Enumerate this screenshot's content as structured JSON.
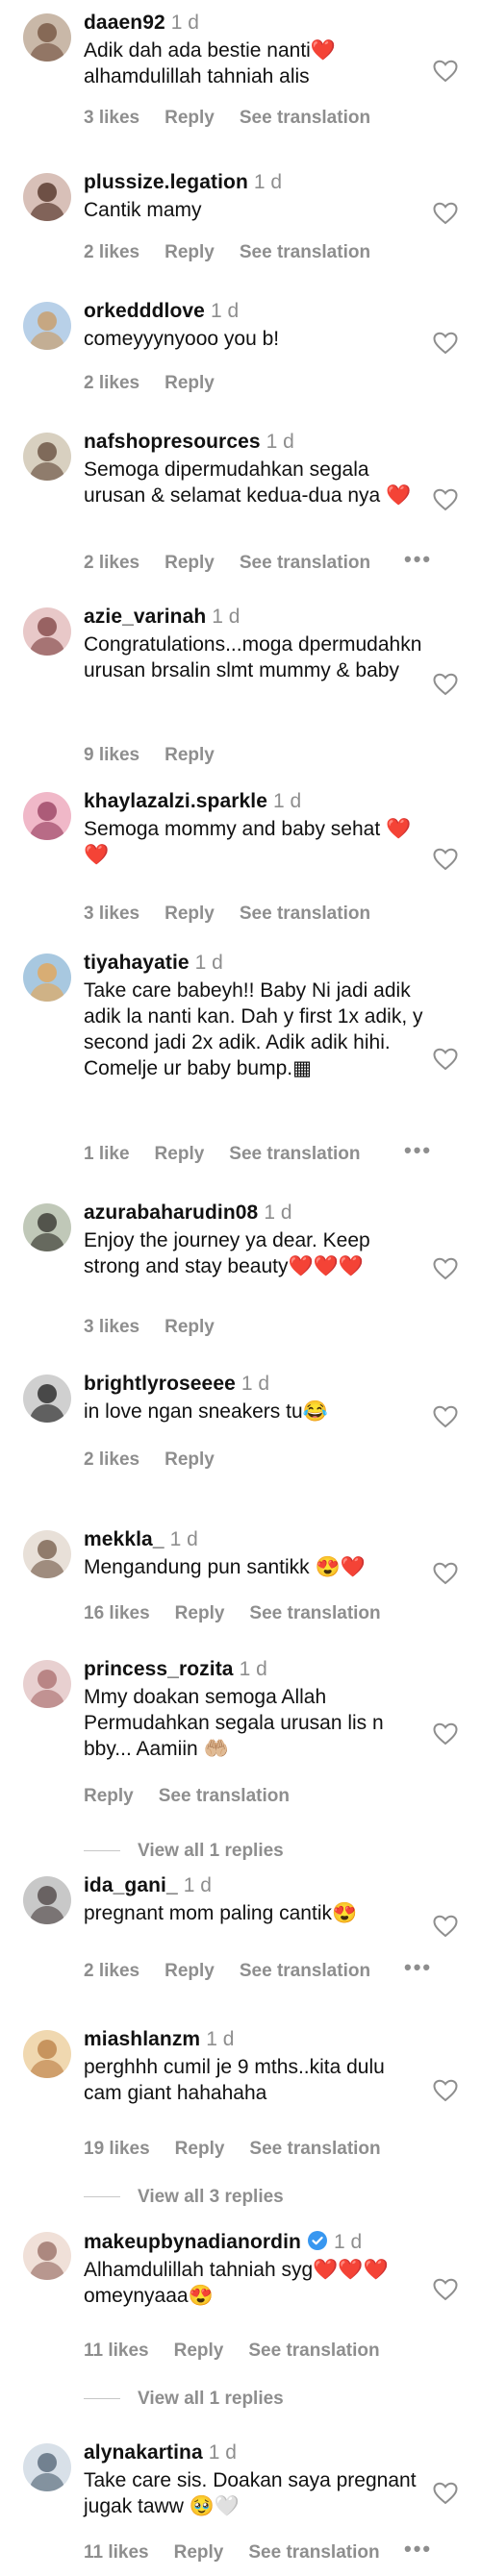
{
  "colors": {
    "text": "#111111",
    "muted": "#8e8e8e",
    "heart_emoji": "#e0102a",
    "verified": "#3897f0"
  },
  "icons": {
    "like": "heart-outline-icon",
    "more": "more-horizontal-icon",
    "verified": "verified-badge-icon"
  },
  "comments": [
    {
      "user": "daaen92",
      "time": "1 d",
      "text": "Adik dah ada bestie nanti❤️ alhamdulillah tahniah alis",
      "likes": "3 likes",
      "reply": "Reply",
      "translate": "See translation"
    },
    {
      "user": "plussize.legation",
      "time": "1 d",
      "text": "Cantik mamy",
      "likes": "2 likes",
      "reply": "Reply",
      "translate": "See translation"
    },
    {
      "user": "orkedddlove",
      "time": "1 d",
      "text": "comeyyynyooo you b!",
      "likes": "2 likes",
      "reply": "Reply"
    },
    {
      "user": "nafshopresources",
      "time": "1 d",
      "text": "Semoga dipermudahkan segala urusan & selamat kedua-dua nya ❤️",
      "likes": "2 likes",
      "reply": "Reply",
      "translate": "See translation",
      "more": "•••"
    },
    {
      "user": "azie_varinah",
      "time": "1 d",
      "text": "Congratulations...moga dpermudahkn urusan brsalin slmt mummy & baby",
      "likes": "9 likes",
      "reply": "Reply"
    },
    {
      "user": "khaylazalzi.sparkle",
      "time": "1 d",
      "text": "Semoga mommy and baby sehat ❤️❤️",
      "likes": "3 likes",
      "reply": "Reply",
      "translate": "See translation"
    },
    {
      "user": "tiyahayatie",
      "time": "1 d",
      "text": "Take care babeyh!! Baby Ni jadi adik adik la nanti kan. Dah y first 1x adik, y second jadi 2x adik. Adik adik hihi. Comelje ur baby bump.▦",
      "likes": "1 like",
      "reply": "Reply",
      "translate": "See translation",
      "more": "•••"
    },
    {
      "user": "azurabaharudin08",
      "time": "1 d",
      "text": "Enjoy the journey ya dear. Keep strong and stay beauty❤️❤️❤️",
      "likes": "3 likes",
      "reply": "Reply"
    },
    {
      "user": "brightlyroseeee",
      "time": "1 d",
      "text": "in love ngan sneakers tu😂",
      "likes": "2 likes",
      "reply": "Reply"
    },
    {
      "user": "mekkla_",
      "time": "1 d",
      "text": "Mengandung pun santikk 😍❤️",
      "likes": "16 likes",
      "reply": "Reply",
      "translate": "See translation"
    },
    {
      "user": "princess_rozita",
      "time": "1 d",
      "text": "Mmy doakan semoga Allah Permudahkan segala urusan lis n bby... Aamiin 🤲🏼",
      "reply": "Reply",
      "translate": "See translation",
      "view_replies": "View all 1 replies"
    },
    {
      "user": "ida_gani_",
      "time": "1 d",
      "text": "pregnant mom paling cantik😍",
      "likes": "2 likes",
      "reply": "Reply",
      "translate": "See translation",
      "more": "•••"
    },
    {
      "user": "miashlanzm",
      "time": "1 d",
      "text": "perghhh cumil je 9 mths..kita dulu cam giant hahahaha",
      "likes": "19 likes",
      "reply": "Reply",
      "translate": "See translation",
      "view_replies": "View all 3 replies"
    },
    {
      "user": "makeupbynadianordin",
      "time": "1 d",
      "verified": true,
      "text": "Alhamdulillah tahniah syg❤️❤️❤️ omeynyaaa😍",
      "likes": "11 likes",
      "reply": "Reply",
      "translate": "See translation",
      "view_replies": "View all 1 replies"
    },
    {
      "user": "alynakartina",
      "time": "1 d",
      "text": "Take care sis. Doakan saya pregnant jugak taww 🥹🤍",
      "likes": "11 likes",
      "reply": "Reply",
      "translate": "See translation",
      "more": "•••"
    }
  ]
}
